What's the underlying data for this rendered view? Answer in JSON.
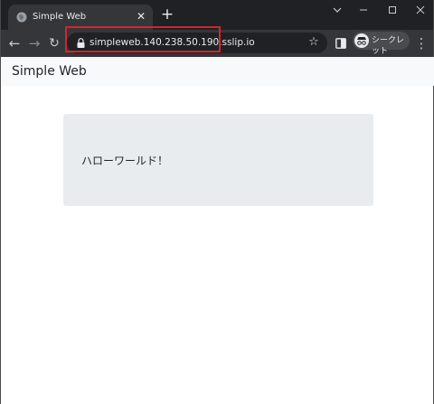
{
  "browser": {
    "tab": {
      "title": "Simple Web",
      "favicon": "globe-icon"
    },
    "address_bar": {
      "url": "simpleweb.140.238.50.190.sslip.io"
    },
    "incognito_label": "シークレット",
    "highlight_color": "#d0262b"
  },
  "page": {
    "brand": "Simple Web",
    "message": "ハローワールド！"
  }
}
